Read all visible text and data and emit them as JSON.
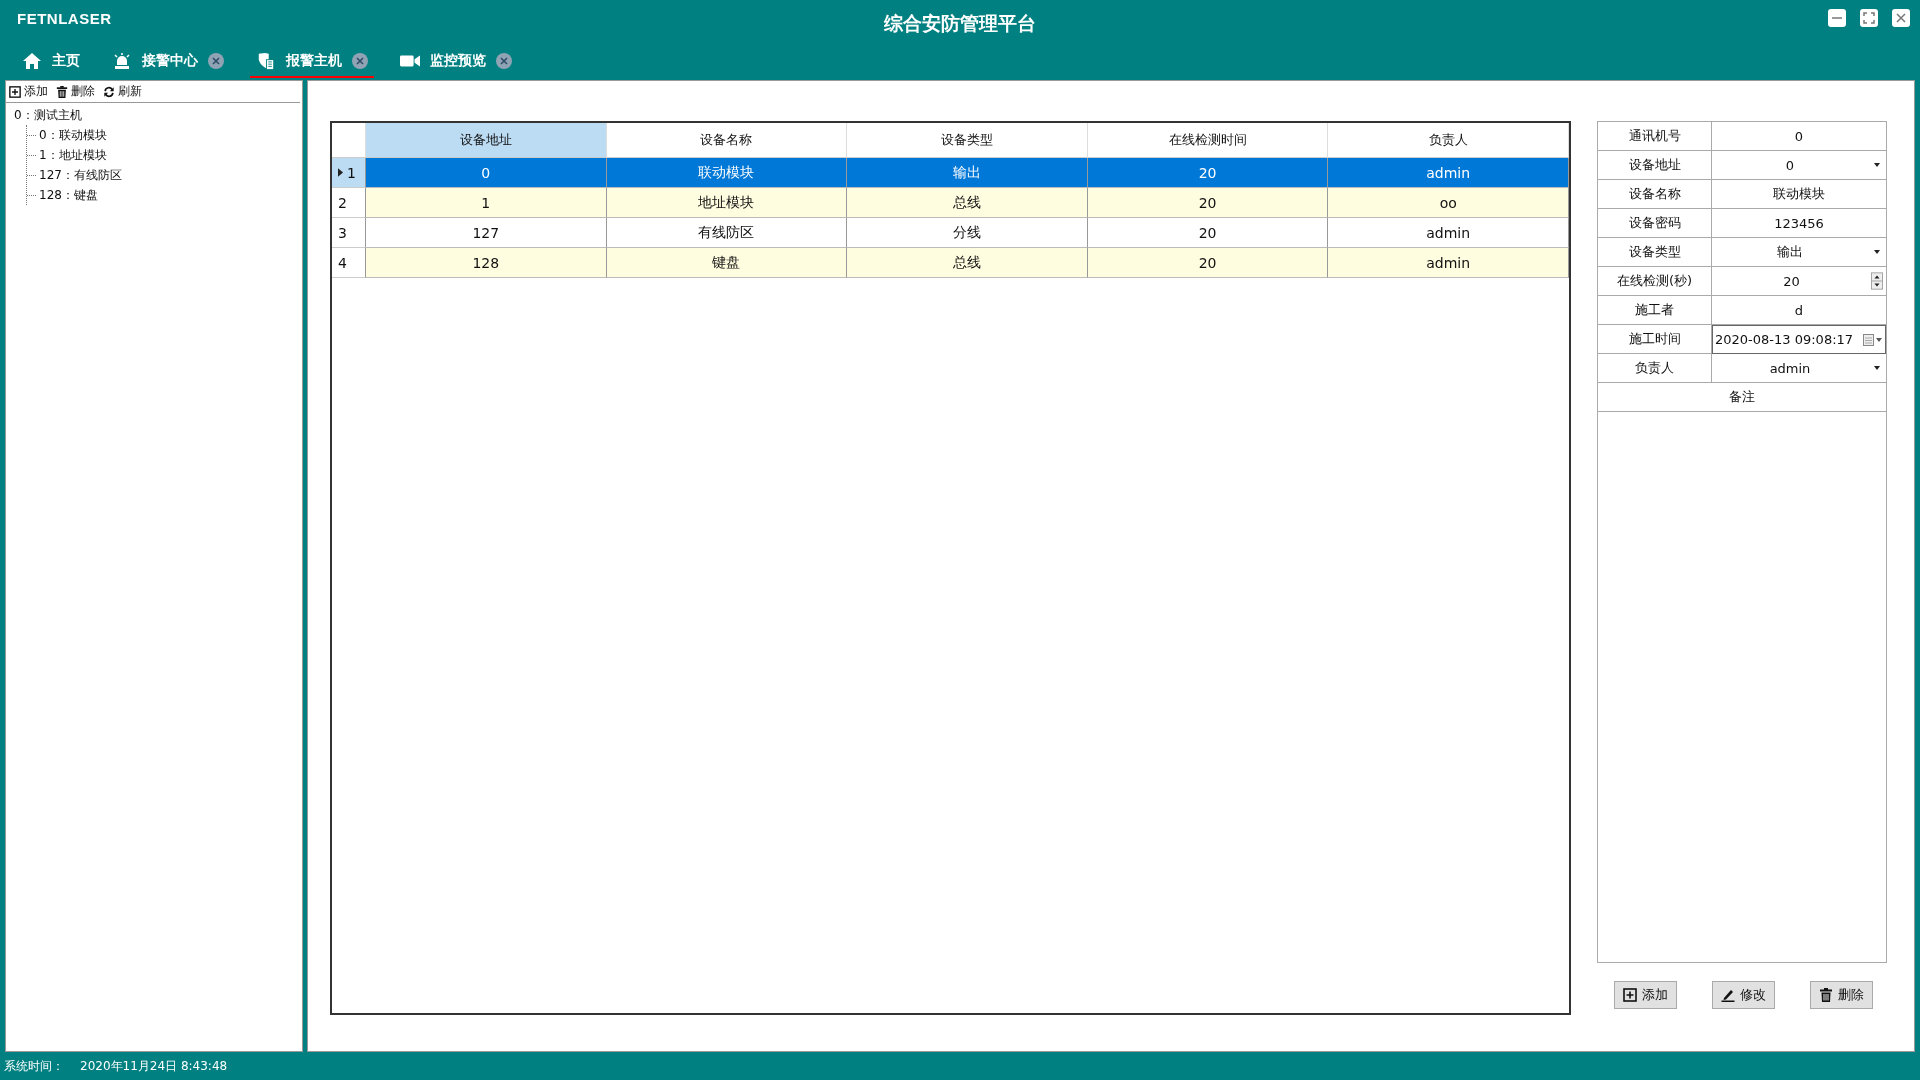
{
  "window": {
    "logo": "FETNLASER",
    "title": "综合安防管理平台"
  },
  "tabs": [
    {
      "label": "主页",
      "closable": false,
      "selected": false
    },
    {
      "label": "接警中心",
      "closable": true,
      "selected": false
    },
    {
      "label": "报警主机",
      "closable": true,
      "selected": true
    },
    {
      "label": "监控预览",
      "closable": true,
      "selected": false
    }
  ],
  "sidebar": {
    "toolbar": [
      {
        "label": "添加"
      },
      {
        "label": "删除"
      },
      {
        "label": "刷新"
      }
    ],
    "tree": [
      {
        "label": "0：测试主机",
        "children": [
          {
            "label": "0：联动模块"
          },
          {
            "label": "1：地址模块"
          },
          {
            "label": "127：有线防区"
          },
          {
            "label": "128：键盘"
          }
        ]
      }
    ]
  },
  "table": {
    "columns": [
      {
        "label": "设备地址",
        "highlighted": true
      },
      {
        "label": "设备名称",
        "highlighted": false
      },
      {
        "label": "设备类型",
        "highlighted": false
      },
      {
        "label": "在线检测时间",
        "highlighted": false
      },
      {
        "label": "负责人",
        "highlighted": false
      }
    ],
    "rows": [
      {
        "index": "1",
        "selected": true,
        "cells": [
          "0",
          "联动模块",
          "输出",
          "20",
          "admin"
        ]
      },
      {
        "index": "2",
        "selected": false,
        "cells": [
          "1",
          "地址模块",
          "总线",
          "20",
          "oo"
        ]
      },
      {
        "index": "3",
        "selected": false,
        "cells": [
          "127",
          "有线防区",
          "分线",
          "20",
          "admin"
        ]
      },
      {
        "index": "4",
        "selected": false,
        "cells": [
          "128",
          "键盘",
          "总线",
          "20",
          "admin"
        ]
      }
    ]
  },
  "form": {
    "fields": [
      {
        "label": "通讯机号",
        "kind": "text",
        "value": "0"
      },
      {
        "label": "设备地址",
        "kind": "dropdown",
        "value": "0"
      },
      {
        "label": "设备名称",
        "kind": "text",
        "value": "联动模块"
      },
      {
        "label": "设备密码",
        "kind": "text",
        "value": "123456"
      },
      {
        "label": "设备类型",
        "kind": "dropdown",
        "value": "输出"
      },
      {
        "label": "在线检测(秒)",
        "kind": "spinner",
        "value": "20"
      },
      {
        "label": "施工者",
        "kind": "text",
        "value": "d"
      },
      {
        "label": "施工时间",
        "kind": "datetime",
        "value": "2020-08-13 09:08:17"
      },
      {
        "label": "负责人",
        "kind": "dropdown",
        "value": "admin"
      }
    ],
    "notes_label": "备注",
    "buttons": [
      {
        "label": "添加"
      },
      {
        "label": "修改"
      },
      {
        "label": "删除"
      }
    ]
  },
  "status_bar": {
    "label": "系统时间：",
    "time": "2020年11月24日 8:43:48"
  }
}
